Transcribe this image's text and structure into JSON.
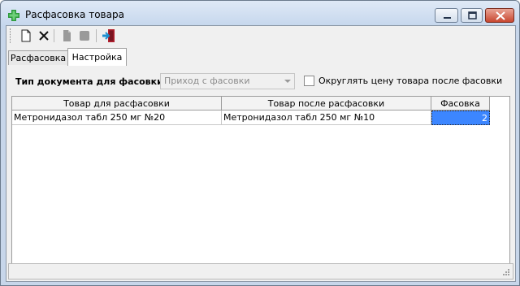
{
  "window": {
    "title": "Расфасовка товара"
  },
  "toolbar": {
    "buttons": [
      {
        "name": "new-document-icon",
        "enabled": true
      },
      {
        "name": "delete-x-icon",
        "enabled": true
      },
      {
        "name": "document-disabled-icon",
        "enabled": false
      },
      {
        "name": "stop-disabled-icon",
        "enabled": false
      },
      {
        "name": "exit-door-icon",
        "enabled": true
      }
    ]
  },
  "tabs": [
    {
      "label": "Расфасовка",
      "active": false
    },
    {
      "label": "Настройка",
      "active": true
    }
  ],
  "settings": {
    "doc_type_label": "Тип документа для фасовки",
    "doc_type_value": "Приход с фасовки",
    "round_price_label": "Округлять цену товара после фасовки",
    "round_price_checked": false
  },
  "grid": {
    "columns": [
      "Товар для расфасовки",
      "Товар после расфасовки",
      "Фасовка"
    ],
    "rows": [
      {
        "source": "Метронидазол табл 250 мг №20",
        "target": "Метронидазол табл 250 мг №10",
        "pack": "2"
      }
    ]
  },
  "colors": {
    "selection": "#3c86ff",
    "close_button": "#c8462f",
    "titlebar": "#c3d5ec"
  }
}
